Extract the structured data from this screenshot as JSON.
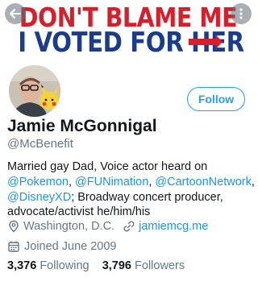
{
  "banner": {
    "line1": "DON'T BLAME ME",
    "line2_prefix": "I VOTED FOR ",
    "line2_h": "H",
    "line2_suffix": "ER"
  },
  "nav": {
    "back_icon": "back-arrow-icon",
    "more_icon": "more-vertical-icon"
  },
  "profile": {
    "name": "Jamie McGonnigal",
    "handle": "@McBenefit",
    "follow_label": "Follow",
    "bio": {
      "line1": "Married gay Dad, Voice actor heard on",
      "m1": "@Pokemon",
      "sep1": ", ",
      "m2": "@FUNimation",
      "sep2": ", ",
      "m3": "@CartoonNetwork",
      "sep3": ",",
      "m4": "@DisneyXD",
      "line3_rest": "; Broadway concert producer,",
      "line4": "advocate/activist  he/him/his"
    },
    "location": "Washington, D.C.",
    "website": "jamiemcg.me",
    "joined": "Joined June 2009",
    "following_count": "3,376",
    "following_label": "Following",
    "followers_count": "3,796",
    "followers_label": "Followers"
  },
  "colors": {
    "accent": "#1da1f2",
    "link": "#1b95e0",
    "banner_red": "#d51f2a",
    "banner_blue": "#1b3c8d",
    "secondary_text": "#657786"
  }
}
